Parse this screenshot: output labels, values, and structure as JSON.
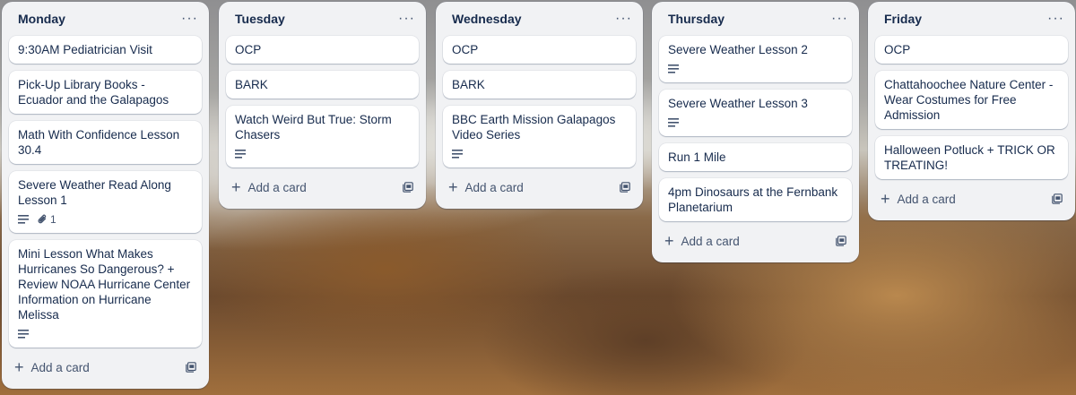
{
  "lists": [
    {
      "title": "Monday",
      "menu": "···",
      "add_label": "Add a card",
      "cards": [
        {
          "title": "9:30AM Pediatrician Visit",
          "description": false
        },
        {
          "title": "Pick-Up Library Books - Ecuador and the Galapagos",
          "description": false
        },
        {
          "title": "Math With Confidence Lesson 30.4",
          "description": false
        },
        {
          "title": "Severe Weather Read Along Lesson 1",
          "description": true,
          "attachments": "1"
        },
        {
          "title": "Mini Lesson What Makes Hurricanes So Dangerous? + Review NOAA Hurricane Center Information on Hurricane Melissa",
          "description": true
        }
      ]
    },
    {
      "title": "Tuesday",
      "menu": "···",
      "add_label": "Add a card",
      "cards": [
        {
          "title": "OCP",
          "description": false
        },
        {
          "title": "BARK",
          "description": false
        },
        {
          "title": "Watch Weird But True: Storm Chasers",
          "description": true
        }
      ]
    },
    {
      "title": "Wednesday",
      "menu": "···",
      "add_label": "Add a card",
      "cards": [
        {
          "title": "OCP",
          "description": false
        },
        {
          "title": "BARK",
          "description": false
        },
        {
          "title": "BBC Earth Mission Galapagos Video Series",
          "description": true
        }
      ]
    },
    {
      "title": "Thursday",
      "menu": "···",
      "add_label": "Add a card",
      "cards": [
        {
          "title": "Severe Weather Lesson 2",
          "description": true
        },
        {
          "title": "Severe Weather Lesson 3",
          "description": true
        },
        {
          "title": "Run 1 Mile",
          "description": false
        },
        {
          "title": "4pm Dinosaurs at the Fernbank Planetarium",
          "description": false
        }
      ]
    },
    {
      "title": "Friday",
      "menu": "···",
      "add_label": "Add a card",
      "cards": [
        {
          "title": "OCP",
          "description": false
        },
        {
          "title": "Chattahoochee Nature Center - Wear Costumes for Free Admission",
          "description": false
        },
        {
          "title": "Halloween Potluck + TRICK OR TREATING!",
          "description": false
        }
      ]
    }
  ],
  "icons": {
    "menu": "more-horizontal-icon",
    "description": "description-icon",
    "attachment": "paperclip-icon",
    "add": "plus-icon",
    "template": "card-template-icon"
  },
  "colors": {
    "list_bg": "#f1f2f4",
    "card_bg": "#ffffff",
    "text": "#172b4d",
    "subtle_text": "#44546f"
  }
}
